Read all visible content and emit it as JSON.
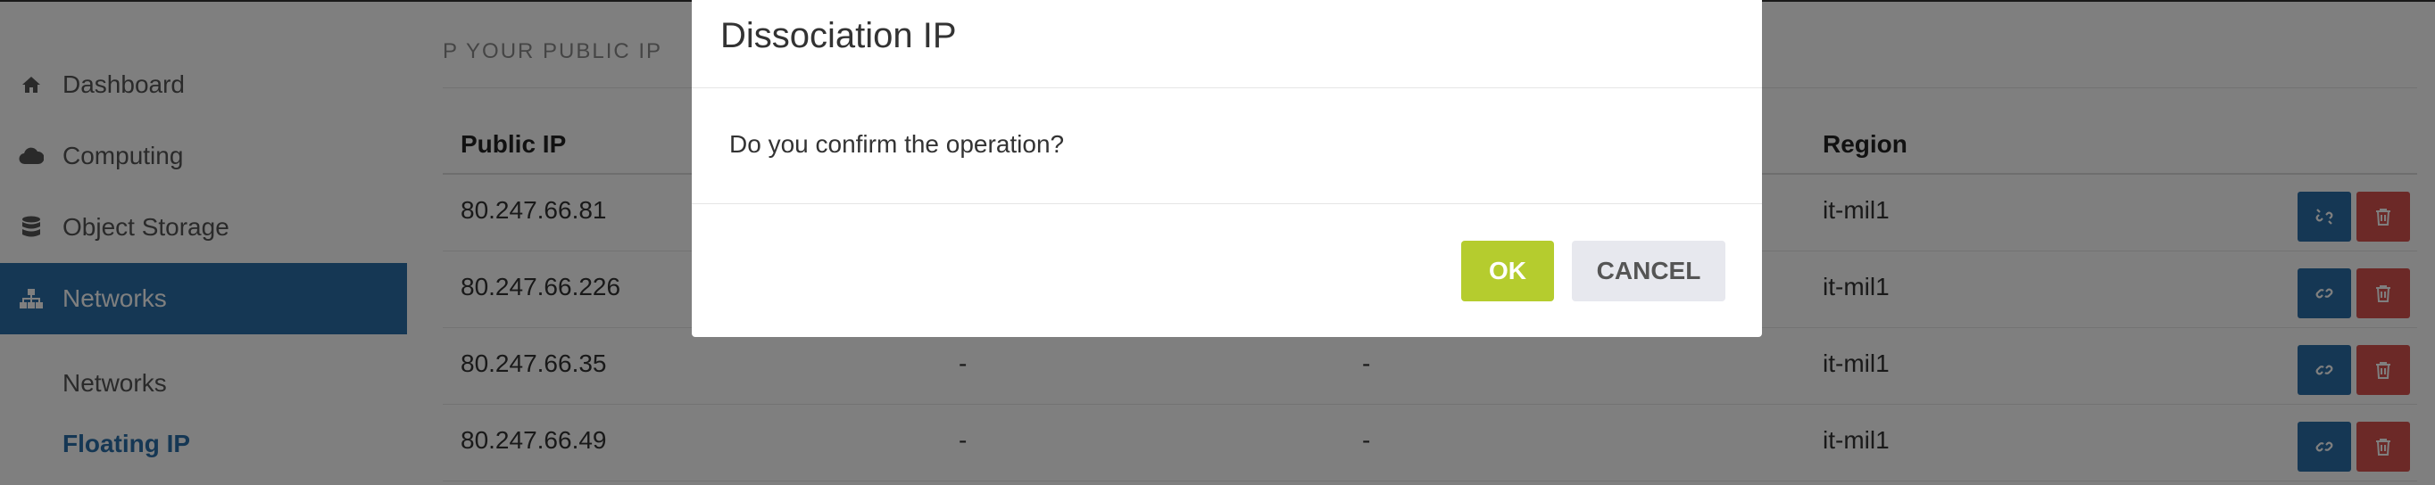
{
  "sidebar": {
    "items": [
      {
        "label": "Dashboard",
        "icon": "home-icon"
      },
      {
        "label": "Computing",
        "icon": "cloud-icon"
      },
      {
        "label": "Object Storage",
        "icon": "database-icon"
      },
      {
        "label": "Networks",
        "icon": "sitemap-icon",
        "active": true
      }
    ],
    "subitems": [
      {
        "label": "Networks"
      },
      {
        "label": "Floating IP",
        "active": true
      }
    ]
  },
  "main": {
    "heading": "YOUR PUBLIC IP",
    "heading_icon": "P",
    "table": {
      "columns": [
        "Public IP",
        "Region"
      ],
      "rows": [
        {
          "ip": "80.247.66.81",
          "col2": "",
          "col3": "",
          "region": "it-mil1"
        },
        {
          "ip": "80.247.66.226",
          "col2": "",
          "col3": "",
          "region": "it-mil1"
        },
        {
          "ip": "80.247.66.35",
          "col2": "-",
          "col3": "-",
          "region": "it-mil1"
        },
        {
          "ip": "80.247.66.49",
          "col2": "-",
          "col3": "-",
          "region": "it-mil1"
        }
      ]
    }
  },
  "modal": {
    "title": "Dissociation IP",
    "message": "Do you confirm the operation?",
    "ok_label": "OK",
    "cancel_label": "CANCEL"
  },
  "colors": {
    "primary": "#2a6fa8",
    "danger": "#d9534f",
    "ok": "#b5cc2e",
    "cancel": "#e7e8ee"
  }
}
